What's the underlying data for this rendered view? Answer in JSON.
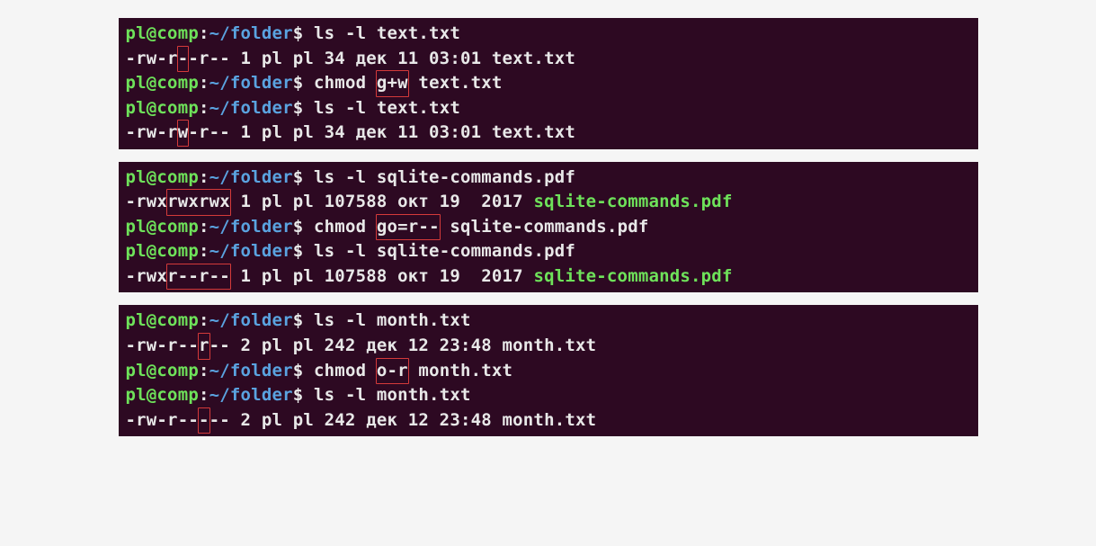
{
  "prompt": {
    "user": "pl@comp",
    "sep": ":",
    "path": "~/folder",
    "sigil": "$"
  },
  "blocks": [
    {
      "lines": [
        {
          "type": "prompt",
          "cmd": "ls -l text.txt"
        },
        {
          "type": "perm",
          "perm_pre": "-rw-r",
          "perm_hl": "-",
          "perm_post": "-r--",
          "rest": " 1 pl pl 34 дек 11 03:01 text.txt",
          "exec": ""
        },
        {
          "type": "prompt",
          "cmd_pre": "chmod ",
          "cmd_hl": "g+w",
          "cmd_post": " text.txt"
        },
        {
          "type": "prompt",
          "cmd": "ls -l text.txt"
        },
        {
          "type": "perm",
          "perm_pre": "-rw-r",
          "perm_hl": "w",
          "perm_post": "-r--",
          "rest": " 1 pl pl 34 дек 11 03:01 text.txt",
          "exec": ""
        }
      ]
    },
    {
      "lines": [
        {
          "type": "prompt",
          "cmd": "ls -l sqlite-commands.pdf"
        },
        {
          "type": "perm",
          "perm_pre": "-rwx",
          "perm_hl": "rwxrwx",
          "perm_post": "",
          "rest": " 1 pl pl 107588 окт 19  2017 ",
          "exec": "sqlite-commands.pdf"
        },
        {
          "type": "prompt",
          "cmd_pre": "chmod ",
          "cmd_hl": "go=r--",
          "cmd_post": " sqlite-commands.pdf"
        },
        {
          "type": "prompt",
          "cmd": "ls -l sqlite-commands.pdf"
        },
        {
          "type": "perm",
          "perm_pre": "-rwx",
          "perm_hl": "r--r--",
          "perm_post": "",
          "rest": " 1 pl pl 107588 окт 19  2017 ",
          "exec": "sqlite-commands.pdf"
        }
      ]
    },
    {
      "lines": [
        {
          "type": "prompt",
          "cmd": "ls -l month.txt"
        },
        {
          "type": "perm",
          "perm_pre": "-rw-r--",
          "perm_hl": "r",
          "perm_post": "--",
          "rest": " 2 pl pl 242 дек 12 23:48 month.txt",
          "exec": ""
        },
        {
          "type": "prompt",
          "cmd_pre": "chmod ",
          "cmd_hl": "o-r",
          "cmd_post": " month.txt"
        },
        {
          "type": "prompt",
          "cmd": "ls -l month.txt"
        },
        {
          "type": "perm",
          "perm_pre": "-rw-r--",
          "perm_hl": "-",
          "perm_post": "--",
          "rest": " 2 pl pl 242 дек 12 23:48 month.txt",
          "exec": ""
        }
      ]
    }
  ]
}
